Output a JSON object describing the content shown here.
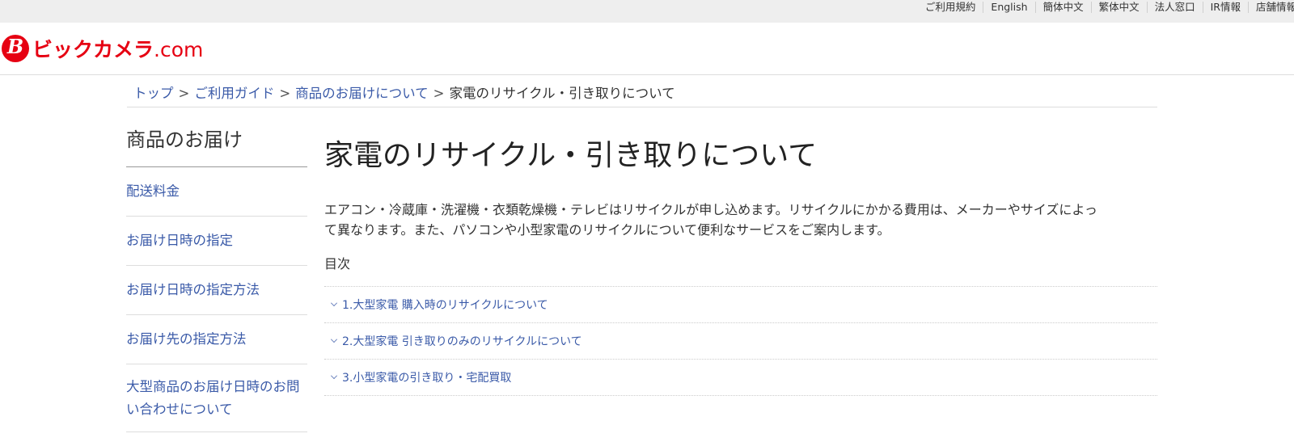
{
  "utility_nav": [
    "ご利用規約",
    "English",
    "簡体中文",
    "繁体中文",
    "法人窓口",
    "IR情報",
    "店舗情報"
  ],
  "brand": {
    "mark": "B",
    "name": "ビックカメラ",
    "suffix": ".com",
    "color": "#e60012"
  },
  "breadcrumb": {
    "items": [
      "トップ",
      "ご利用ガイド",
      "商品のお届けについて"
    ],
    "separator": ">",
    "current": "家電のリサイクル・引き取りについて"
  },
  "sidebar": {
    "title": "商品のお届け",
    "items": [
      "配送料金",
      "お届け日時の指定",
      "お届け日時の指定方法",
      "お届け先の指定方法",
      "大型商品のお届け日時のお問い合わせについて"
    ]
  },
  "main": {
    "title": "家電のリサイクル・引き取りについて",
    "intro_line1": "エアコン・冷蔵庫・洗濯機・衣類乾燥機・テレビはリサイクルが申し込めます。リサイクルにかかる費用は、メーカーやサイズによっ",
    "intro_line2": "て異なります。また、パソコンや小型家電のリサイクルについて便利なサービスをご案内します。",
    "toc_label": "目次",
    "toc": [
      "1.大型家電 購入時のリサイクルについて",
      "2.大型家電 引き取りのみのリサイクルについて",
      "3.小型家電の引き取り・宅配買取"
    ]
  },
  "colors": {
    "link": "#3a5aa8",
    "utility_bar": "#eeeeee",
    "brand_red": "#e60012"
  }
}
